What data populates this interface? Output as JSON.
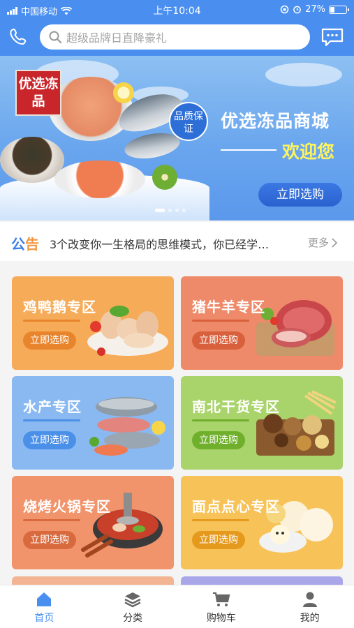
{
  "status_bar": {
    "carrier": "中国移动",
    "time": "上午10:04",
    "battery": "27%"
  },
  "header": {
    "search_placeholder": "超级品牌日直降豪礼",
    "phone_icon": "phone-icon",
    "message_icon": "chat-icon"
  },
  "banner": {
    "tag": "优选冻品",
    "badge": "品质保证",
    "title": "优选冻品商城",
    "welcome": "欢迎您",
    "button": "立即选购"
  },
  "notice": {
    "label_part1": "公",
    "label_part2": "告",
    "text": "3个改变你一生格局的思维模式，你已经学…",
    "more": "更多"
  },
  "categories": [
    {
      "title": "鸡鸭鹅专区",
      "button": "立即选购",
      "bg": "#f6ab58",
      "accent": "#e8852c"
    },
    {
      "title": "猪牛羊专区",
      "button": "立即选购",
      "bg": "#ee8a6a",
      "accent": "#d8603c"
    },
    {
      "title": "水产专区",
      "button": "立即选购",
      "bg": "#8ab9f2",
      "accent": "#4a8fe8"
    },
    {
      "title": "南北干货专区",
      "button": "立即选购",
      "bg": "#a9d36b",
      "accent": "#6faf2c"
    },
    {
      "title": "烧烤火锅专区",
      "button": "立即选购",
      "bg": "#f1946c",
      "accent": "#d86a3e"
    },
    {
      "title": "面点点心专区",
      "button": "立即选购",
      "bg": "#f7c257",
      "accent": "#e59a1e"
    }
  ],
  "tabs": [
    {
      "label": "首页",
      "icon": "home-icon",
      "active": true
    },
    {
      "label": "分类",
      "icon": "layers-icon",
      "active": false
    },
    {
      "label": "购物车",
      "icon": "cart-icon",
      "active": false
    },
    {
      "label": "我的",
      "icon": "user-icon",
      "active": false
    }
  ],
  "colors": {
    "primary": "#4a8ff0",
    "notice_blue": "#3b7ee8",
    "notice_orange": "#f29640"
  }
}
